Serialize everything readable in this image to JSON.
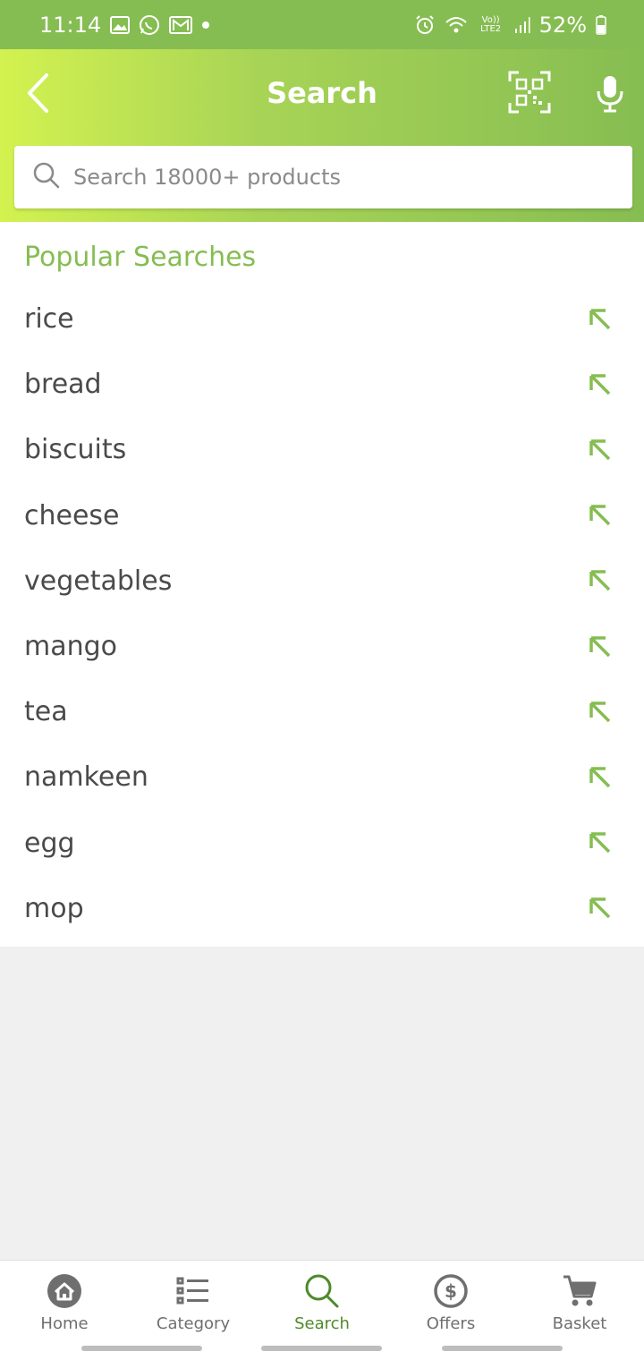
{
  "status_bar": {
    "time": "11:14",
    "battery": "52%",
    "network": "Vo)) LTE2",
    "icons": [
      "gallery-icon",
      "whatsapp-icon",
      "gmail-icon",
      "dot-icon",
      "alarm-icon",
      "wifi-icon",
      "signal-icon",
      "battery-icon"
    ]
  },
  "header": {
    "title": "Search",
    "back_icon": "back-arrow-icon",
    "qr_icon": "qr-scan-icon",
    "mic_icon": "microphone-icon"
  },
  "search": {
    "placeholder": "Search 18000+ products",
    "value": ""
  },
  "popular": {
    "title": "Popular Searches",
    "items": [
      {
        "label": "rice"
      },
      {
        "label": "bread"
      },
      {
        "label": "biscuits"
      },
      {
        "label": "cheese"
      },
      {
        "label": "vegetables"
      },
      {
        "label": "mango"
      },
      {
        "label": "tea"
      },
      {
        "label": "namkeen"
      },
      {
        "label": "egg"
      },
      {
        "label": "mop"
      }
    ]
  },
  "bottom_nav": {
    "items": [
      {
        "label": "Home",
        "icon": "home-icon",
        "active": false
      },
      {
        "label": "Category",
        "icon": "list-icon",
        "active": false
      },
      {
        "label": "Search",
        "icon": "search-icon",
        "active": true
      },
      {
        "label": "Offers",
        "icon": "dollar-icon",
        "active": false
      },
      {
        "label": "Basket",
        "icon": "cart-icon",
        "active": false
      }
    ]
  },
  "colors": {
    "brand_green": "#86bd52",
    "gradient_start": "#d3f250",
    "active_nav": "#4e8a2a",
    "text": "#4a4a4a"
  }
}
